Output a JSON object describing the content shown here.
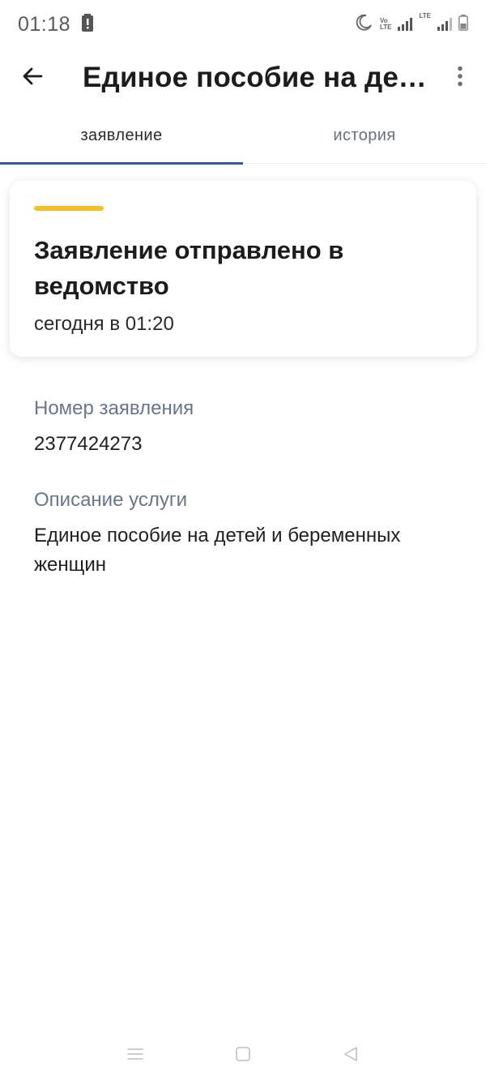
{
  "status_bar": {
    "time": "01:18",
    "volte_top": "Vo",
    "volte_bottom": "LTE",
    "lte_label": "LTE"
  },
  "app_bar": {
    "title": "Единое пособие на детей и беременных женщин",
    "back_icon": "arrow-left-icon",
    "more_icon": "more-vertical-icon"
  },
  "tabs": [
    {
      "label": "заявление",
      "active": true
    },
    {
      "label": "история",
      "active": false
    }
  ],
  "status_card": {
    "title": "Заявление отправлено в ведомство",
    "time": "сегодня в 01:20",
    "accent_color": "#f5bf2a"
  },
  "details": {
    "number_label": "Номер заявления",
    "number_value": "2377424273",
    "description_label": "Описание услуги",
    "description_value": "Единое пособие на детей и беременных женщин"
  },
  "colors": {
    "tab_indicator": "#2f5da3",
    "label_text": "#66768c"
  }
}
